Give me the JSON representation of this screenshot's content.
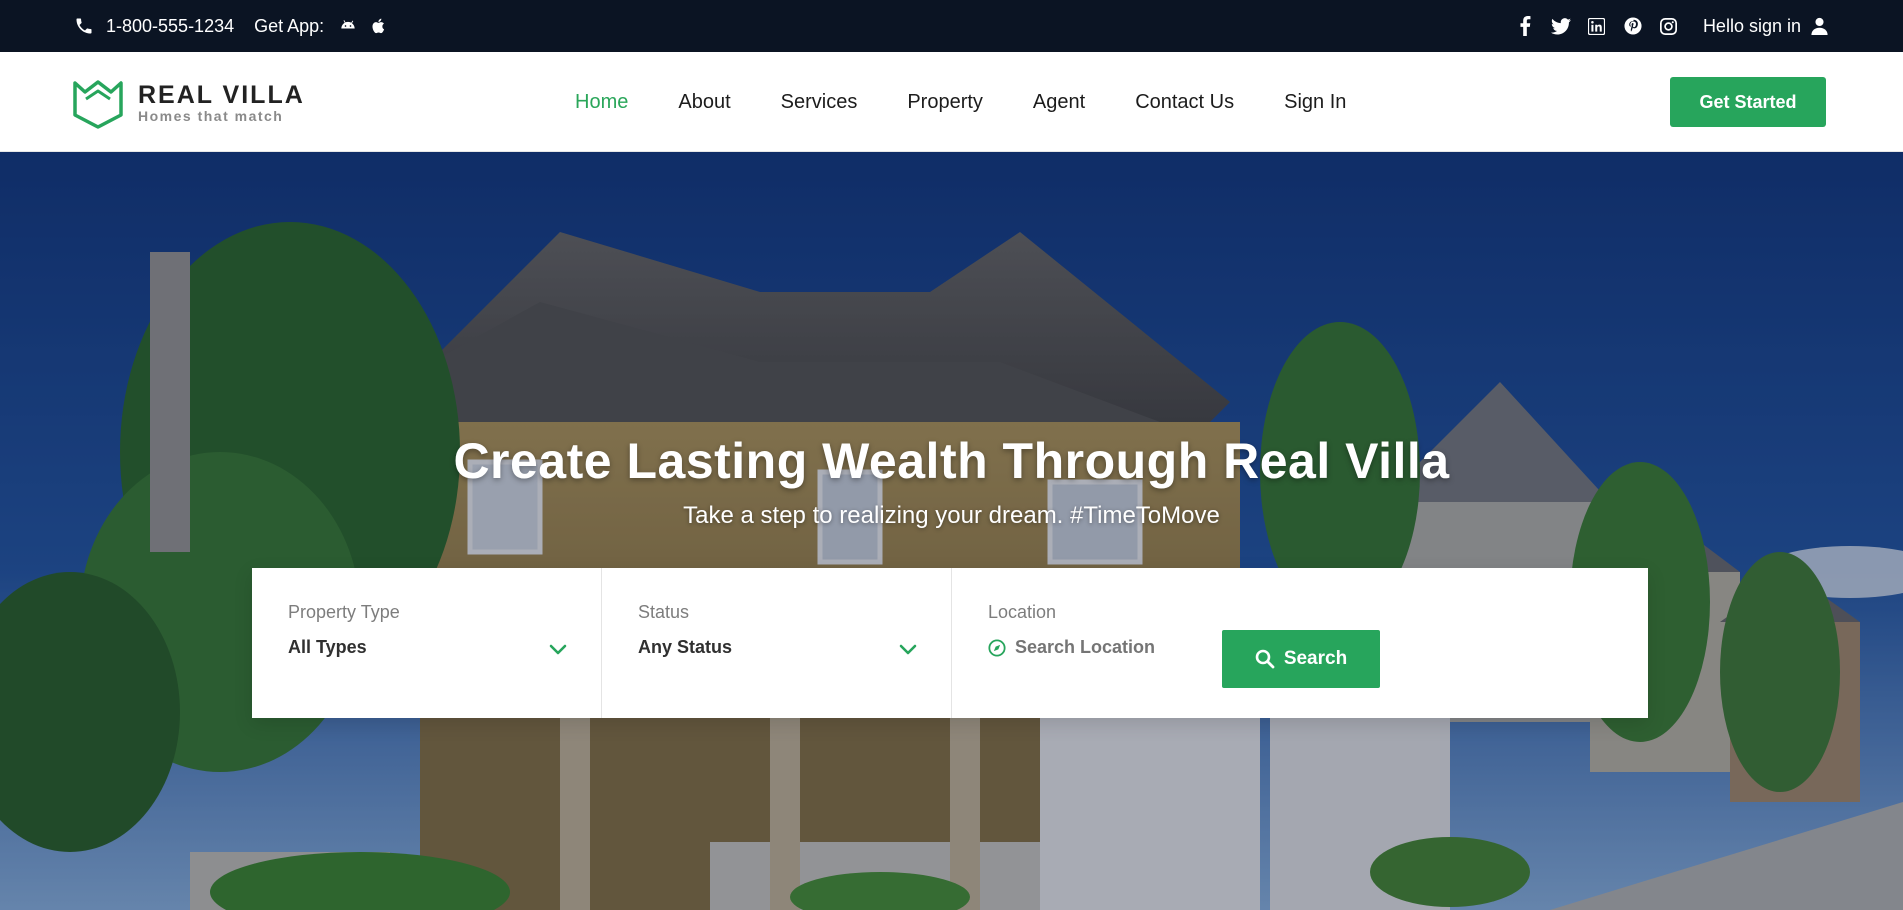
{
  "topbar": {
    "phone": "1-800-555-1234",
    "get_app": "Get App:",
    "app_icons": [
      "android-icon",
      "apple-icon"
    ],
    "social_icons": [
      "facebook-icon",
      "twitter-icon",
      "linkedin-icon",
      "pinterest-icon",
      "instagram-icon"
    ],
    "signin": "Hello sign in"
  },
  "brand": {
    "name": "REAL VILLA",
    "tagline": "Homes that match",
    "accent_color": "#27a55c"
  },
  "nav": {
    "items": [
      {
        "label": "Home",
        "active": true
      },
      {
        "label": "About",
        "active": false
      },
      {
        "label": "Services",
        "active": false
      },
      {
        "label": "Property",
        "active": false
      },
      {
        "label": "Agent",
        "active": false
      },
      {
        "label": "Contact Us",
        "active": false
      },
      {
        "label": "Sign In",
        "active": false
      }
    ],
    "cta": "Get Started"
  },
  "hero": {
    "title": "Create Lasting Wealth Through Real Villa",
    "subtitle": "Take a step to realizing your dream. #TimeToMove"
  },
  "search": {
    "property_type": {
      "label": "Property Type",
      "value": "All Types"
    },
    "status": {
      "label": "Status",
      "value": "Any Status"
    },
    "location": {
      "label": "Location",
      "placeholder": "Search Location"
    },
    "button": "Search"
  }
}
